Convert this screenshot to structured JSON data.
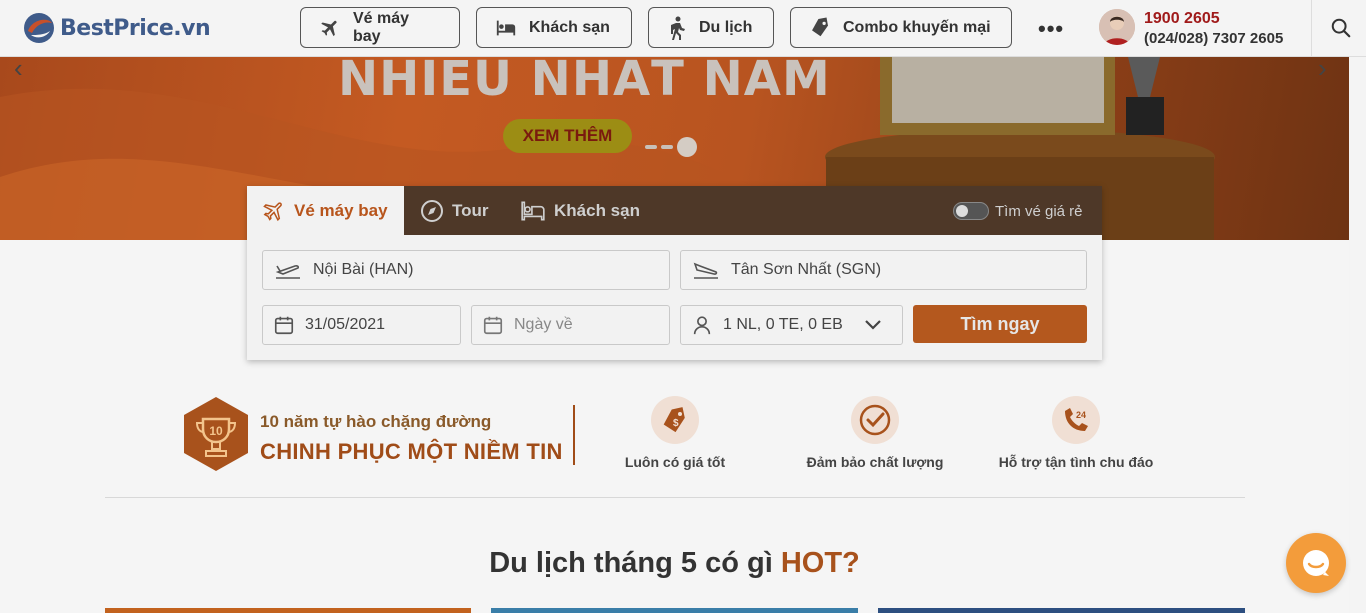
{
  "header": {
    "logo_text": "BestPrice.vn",
    "nav": [
      {
        "label": "Vé máy bay",
        "icon": "plane-icon"
      },
      {
        "label": "Khách sạn",
        "icon": "bed-icon"
      },
      {
        "label": "Du lịch",
        "icon": "hiker-icon"
      },
      {
        "label": "Combo khuyến mại",
        "icon": "tag-icon"
      }
    ],
    "more_label": "•••",
    "hotline": "1900 2605",
    "phone": "(024/028) 7307 2605"
  },
  "banner": {
    "title": "NHIỀU NHẤT NĂM",
    "cta_label": "XEM THÊM"
  },
  "search": {
    "tabs": [
      {
        "label": "Vé máy bay",
        "icon": "plane-icon",
        "active": true
      },
      {
        "label": "Tour",
        "icon": "compass-icon",
        "active": false
      },
      {
        "label": "Khách sạn",
        "icon": "bed-icon",
        "active": false
      }
    ],
    "cheap_toggle_label": "Tìm vé giá rẻ",
    "from": "Nội Bài (HAN)",
    "to": "Tân Sơn Nhất (SGN)",
    "depart_date": "31/05/2021",
    "return_placeholder": "Ngày về",
    "passengers": "1 NL, 0 TE, 0 EB",
    "submit_label": "Tìm ngay"
  },
  "pride": {
    "badge": "10",
    "line1": "10 năm tự hào chặng đường",
    "line2": "CHINH PHỤC MỘT NIỀM TIN"
  },
  "features": [
    {
      "label": "Luôn có giá tốt",
      "icon": "price-tag-icon"
    },
    {
      "label": "Đảm bảo chất lượng",
      "icon": "check-badge-icon"
    },
    {
      "label": "Hỗ trợ tận tình chu đáo",
      "icon": "support-phone-icon"
    }
  ],
  "hot": {
    "prefix": "Du lịch tháng 5 có gì ",
    "accent": "HOT?"
  },
  "colors": {
    "accent": "#b8551c",
    "brand_blue": "#3f5b8a",
    "hotline_red": "#a01a1a"
  }
}
